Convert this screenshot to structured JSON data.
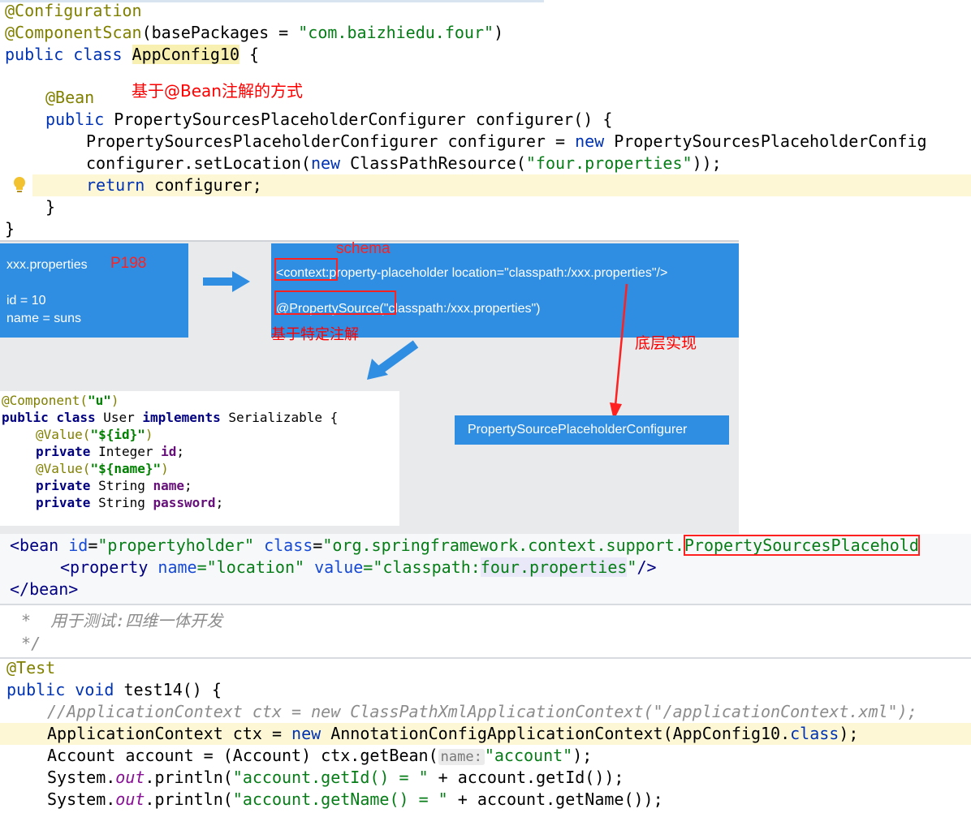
{
  "section1": {
    "line1": "@Configuration",
    "line2_ann": "@ComponentScan",
    "line2_a": "(basePackages = ",
    "line2_str": "\"com.baizhiedu.four\"",
    "line2_b": ")",
    "line3_kw": "public class ",
    "line3_cls": "AppConfig10",
    "line3_b": " {",
    "bean_ann": "@Bean",
    "bean_note": "基于@Bean注解的方式",
    "line5_kw": "public ",
    "line5_rest": "PropertySourcesPlaceholderConfigurer configurer() {",
    "line6_a": "PropertySourcesPlaceholderConfigurer configurer = ",
    "line6_kw": "new",
    "line6_b": " PropertySourcesPlaceholderConfig",
    "line7_a": "configurer.setLocation(",
    "line7_kw": "new",
    "line7_b": " ClassPathResource(",
    "line7_str": "\"four.properties\"",
    "line7_c": "));",
    "line8_kw": "return",
    "line8_b": " configurer;",
    "line9": "}",
    "line10": "}"
  },
  "section2": {
    "props_title": "xxx.properties",
    "props_page": "P198",
    "props_line1": "id = 10",
    "props_line2": "name = suns",
    "schema_label": "schema",
    "context_tag": "<context:",
    "context_rest": "property-placeholder  location=\"classpath:/xxx.properties\"/>",
    "ps_ann": "@PropertySource",
    "ps_rest": "(\"classpath:/xxx.properties\")",
    "special_ann_label": "基于特定注解",
    "bottom_impl_label": "底层实现",
    "configurer_box": "PropertySourcePlaceholderConfigurer",
    "user_l1_ann": "@Component(",
    "user_l1_str": "\"u\"",
    "user_l1_end": ")",
    "user_l2_kw": "public class ",
    "user_l2_name": "User ",
    "user_l2_kw2": "implements ",
    "user_l2_rest": "Serializable {",
    "user_l3_ann": "@Value(",
    "user_l3_str": "\"${id}\"",
    "user_l3_end": ")",
    "user_l4_kw": "private ",
    "user_l4_type": "Integer ",
    "user_l4_field": "id",
    "user_l4_end": ";",
    "user_l5_ann": "@Value(",
    "user_l5_str": "\"${name}\"",
    "user_l5_end": ")",
    "user_l6_kw": "private ",
    "user_l6_type": "String ",
    "user_l6_field": "name",
    "user_l6_end": ";",
    "user_l7_kw": "private ",
    "user_l7_type": "String ",
    "user_l7_field": "password",
    "user_l7_end": ";"
  },
  "section3": {
    "l1_a": "<bean ",
    "l1_attr1": "id",
    "l1_eq1": "=",
    "l1_val1": "\"propertyholder\"",
    "l1_attr2": " class",
    "l1_eq2": "=",
    "l1_val2": "\"org.springframework.context.support.",
    "l1_boxed": "PropertySourcesPlacehold",
    "l2_a": "<property ",
    "l2_attr1": "name",
    "l2_val1": "=\"location\"",
    "l2_attr2": " value",
    "l2_val2a": "=\"classpath:",
    "l2_val2b": "four.properties",
    "l2_val2c": "\"",
    "l2_end": "/>",
    "l3": "</bean>"
  },
  "section4": {
    "c1": " *  用于测试:四维一体开发",
    "c2": " */"
  },
  "section5": {
    "l1": "@Test",
    "l2_kw": "public void ",
    "l2_rest": "test14() {",
    "l3": "//ApplicationContext ctx = new ClassPathXmlApplicationContext(\"/applicationContext.xml\");",
    "l4_a": "ApplicationContext ctx = ",
    "l4_kw": "new",
    "l4_b": " AnnotationConfigApplicationContext(AppConfig10.",
    "l4_kw2": "class",
    "l4_c": ");",
    "l5_a": "Account account = (Account) ctx.getBean(",
    "l5_hint": "name:",
    "l5_str": "\"account\"",
    "l5_c": ");",
    "l6_a": "System.",
    "l6_out": "out",
    "l6_b": ".println(",
    "l6_str": "\"account.getId() = \"",
    "l6_c": " + account.getId());",
    "l7_a": "System.",
    "l7_out": "out",
    "l7_b": ".println(",
    "l7_str": "\"account.getName() = \"",
    "l7_c": " + account.getName());"
  }
}
